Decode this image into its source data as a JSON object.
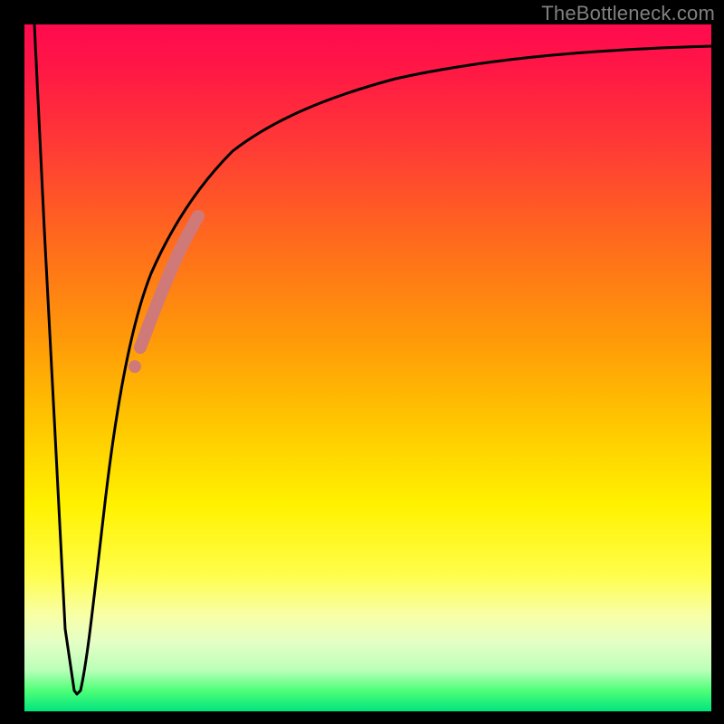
{
  "watermark": "TheBottleneck.com",
  "colors": {
    "frame": "#000000",
    "curve": "#000000",
    "highlight": "#cf7a78",
    "gradient_top": "#ff0a4e",
    "gradient_bottom": "#00e47e"
  },
  "chart_data": {
    "type": "line",
    "title": "",
    "xlabel": "",
    "ylabel": "",
    "xlim": [
      0,
      100
    ],
    "ylim": [
      0,
      100
    ],
    "grid": false,
    "legend": false,
    "series": [
      {
        "name": "bottleneck-curve-left",
        "x": [
          1.5,
          3,
          4.5,
          6,
          7.5
        ],
        "values": [
          100,
          70,
          40,
          12,
          3
        ]
      },
      {
        "name": "bottleneck-curve-right",
        "x": [
          8,
          10,
          12,
          15,
          18,
          22,
          26,
          30,
          36,
          44,
          54,
          66,
          80,
          94,
          100
        ],
        "values": [
          3,
          18,
          32,
          46,
          56,
          65,
          72,
          77,
          82,
          86,
          89.5,
          92,
          94,
          95.5,
          96
        ]
      },
      {
        "name": "highlight-segment",
        "x": [
          17,
          19,
          21,
          23,
          25
        ],
        "values": [
          53,
          58.5,
          63.5,
          67.5,
          71
        ]
      },
      {
        "name": "highlight-dot",
        "x": [
          16
        ],
        "values": [
          50
        ]
      }
    ]
  }
}
